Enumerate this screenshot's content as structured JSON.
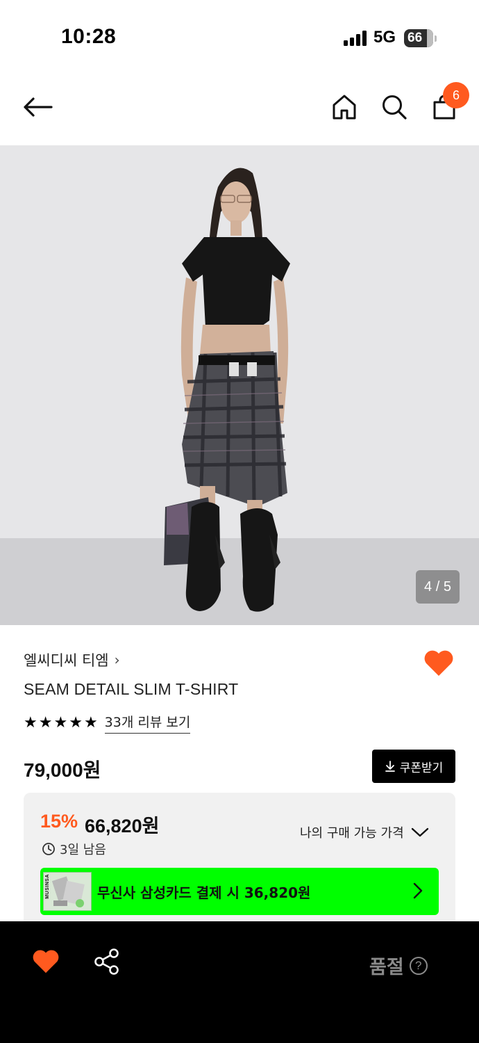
{
  "status_bar": {
    "time": "10:28",
    "network": "5G",
    "battery": "66"
  },
  "header": {
    "cart_count": "6"
  },
  "gallery": {
    "page_indicator": "4 / 5",
    "current_page": 4,
    "total_pages": 5
  },
  "product": {
    "brand": "엘씨디씨 티엠",
    "brand_chevron": "›",
    "title": "SEAM DETAIL SLIM T-SHIRT",
    "rating": 5,
    "stars": [
      "★",
      "★",
      "★",
      "★",
      "★"
    ],
    "review_link": "33개 리뷰 보기",
    "liked": true,
    "price": "79,000원"
  },
  "coupon_button": {
    "label": "쿠폰받기"
  },
  "discount": {
    "percent": "15%",
    "price": "66,820원",
    "time_left": "3일 남음",
    "my_price_label": "나의 구매 가능 가격"
  },
  "card_promo": {
    "thumb_brand": "MUSINSA",
    "text": "무신사 삼성카드 결제 시 36,820원"
  },
  "bottom_bar": {
    "soldout_label": "품절",
    "help_icon": "?"
  },
  "colors": {
    "accent": "#ff5a1f",
    "promo_green": "#00ff00",
    "bottom_bar": "#000000",
    "soldout_text": "#8a8a8a"
  }
}
